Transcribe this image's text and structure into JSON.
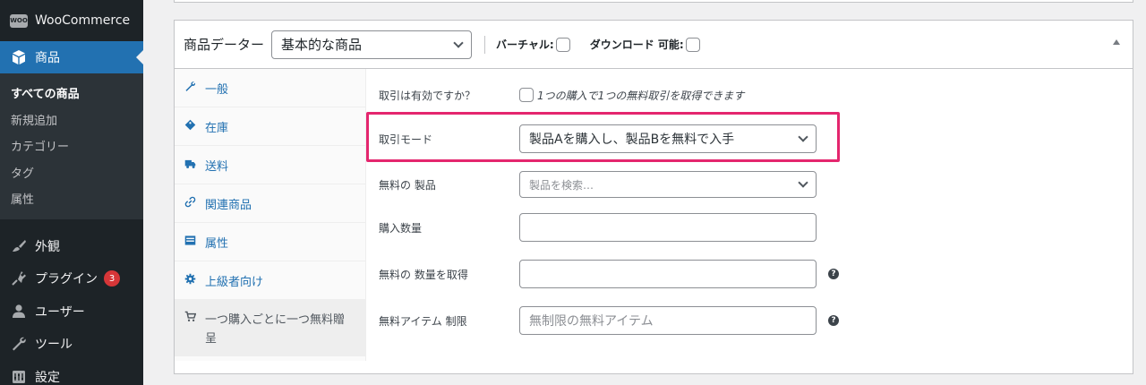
{
  "sidebar": {
    "woocommerce_label": "WooCommerce",
    "products_label": "商品",
    "submenu": [
      {
        "label": "すべての商品",
        "current": true
      },
      {
        "label": "新規追加"
      },
      {
        "label": "カテゴリー"
      },
      {
        "label": "タグ"
      },
      {
        "label": "属性"
      }
    ],
    "appearance_label": "外観",
    "plugins_label": "プラグイン",
    "plugins_badge": "3",
    "users_label": "ユーザー",
    "tools_label": "ツール",
    "settings_label": "設定"
  },
  "product_data": {
    "header_label": "商品データー",
    "type_value": "基本的な商品",
    "virtual_label": "バーチャル:",
    "downloadable_label": "ダウンロード 可能:",
    "tabs": {
      "general": "一般",
      "inventory": "在庫",
      "shipping": "送料",
      "linked": "関連商品",
      "attributes": "属性",
      "advanced": "上級者向け",
      "bogo": "一つ購入ごとに一つ無料贈呈"
    },
    "fields": {
      "enabled_label": "取引は有効ですか？",
      "enabled_desc": "1つの購入で1つの無料取引を取得できます",
      "mode_label": "取引モード",
      "mode_value": "製品Aを購入し、製品Bを無料で入手",
      "free_product_label": "無料の 製品",
      "free_product_placeholder": "製品を検索…",
      "buy_qty_label": "購入数量",
      "buy_qty_value": "",
      "free_qty_label": "無料の 数量を取得",
      "free_qty_value": "",
      "free_limit_label": "無料アイテム 制限",
      "free_limit_placeholder": "無制限の無料アイテム"
    }
  },
  "colors": {
    "sidebar_bg": "#1d2327",
    "accent": "#2271b1",
    "highlight": "#e4266e"
  }
}
